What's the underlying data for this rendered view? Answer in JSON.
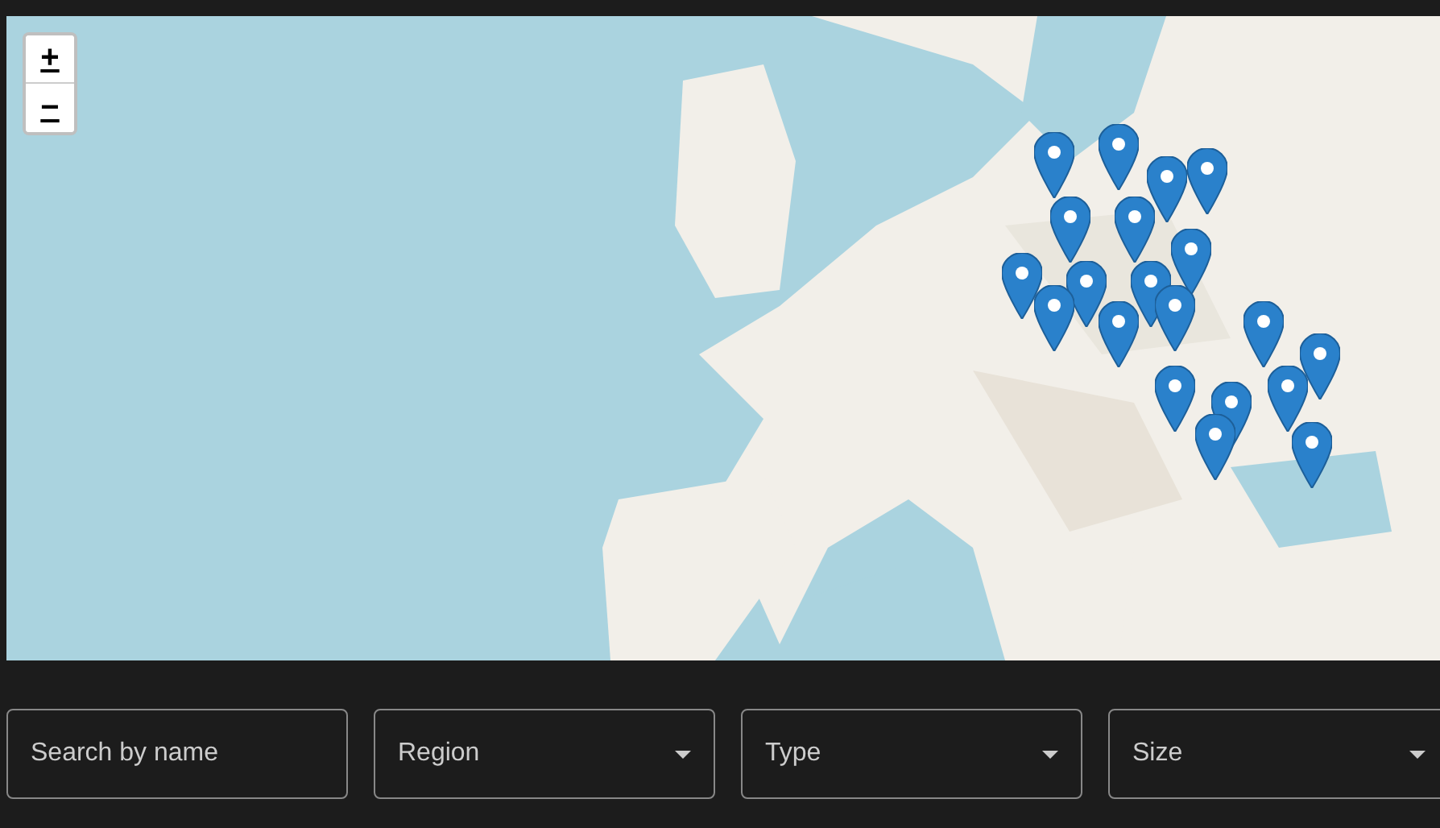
{
  "map": {
    "zoom_controls": [
      {
        "label": "+",
        "kind": "zoom-in"
      },
      {
        "label": "−",
        "kind": "zoom-out"
      }
    ]
  },
  "filters": [
    {
      "kind": "text",
      "placeholder": "Search by name"
    },
    {
      "kind": "select",
      "placeholder": "Region"
    },
    {
      "kind": "select",
      "placeholder": "Type"
    },
    {
      "kind": "select",
      "placeholder": "Size"
    }
  ]
}
